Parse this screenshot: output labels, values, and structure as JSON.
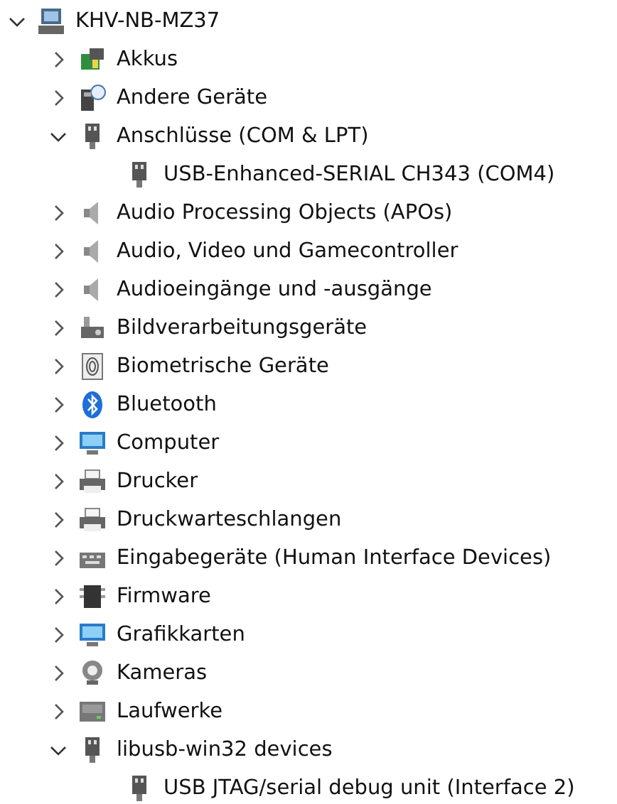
{
  "tree": {
    "label": "KHV-NB-MZ37",
    "expanded": true,
    "children": [
      {
        "label": "Akkus",
        "expanded": false
      },
      {
        "label": "Andere Geräte",
        "expanded": false
      },
      {
        "label": "Anschlüsse (COM & LPT)",
        "expanded": true,
        "children": [
          {
            "label": "USB-Enhanced-SERIAL CH343 (COM4)"
          }
        ]
      },
      {
        "label": "Audio Processing Objects (APOs)",
        "expanded": false
      },
      {
        "label": "Audio, Video und Gamecontroller",
        "expanded": false
      },
      {
        "label": "Audioeingänge und -ausgänge",
        "expanded": false
      },
      {
        "label": "Bildverarbeitungsgeräte",
        "expanded": false
      },
      {
        "label": "Biometrische Geräte",
        "expanded": false
      },
      {
        "label": "Bluetooth",
        "expanded": false
      },
      {
        "label": "Computer",
        "expanded": false
      },
      {
        "label": "Drucker",
        "expanded": false
      },
      {
        "label": "Druckwarteschlangen",
        "expanded": false
      },
      {
        "label": "Eingabegeräte (Human Interface Devices)",
        "expanded": false
      },
      {
        "label": "Firmware",
        "expanded": false
      },
      {
        "label": "Grafikkarten",
        "expanded": false
      },
      {
        "label": "Kameras",
        "expanded": false
      },
      {
        "label": "Laufwerke",
        "expanded": false
      },
      {
        "label": "libusb-win32 devices",
        "expanded": true,
        "children": [
          {
            "label": "USB JTAG/serial debug unit (Interface 2)"
          }
        ]
      }
    ]
  }
}
